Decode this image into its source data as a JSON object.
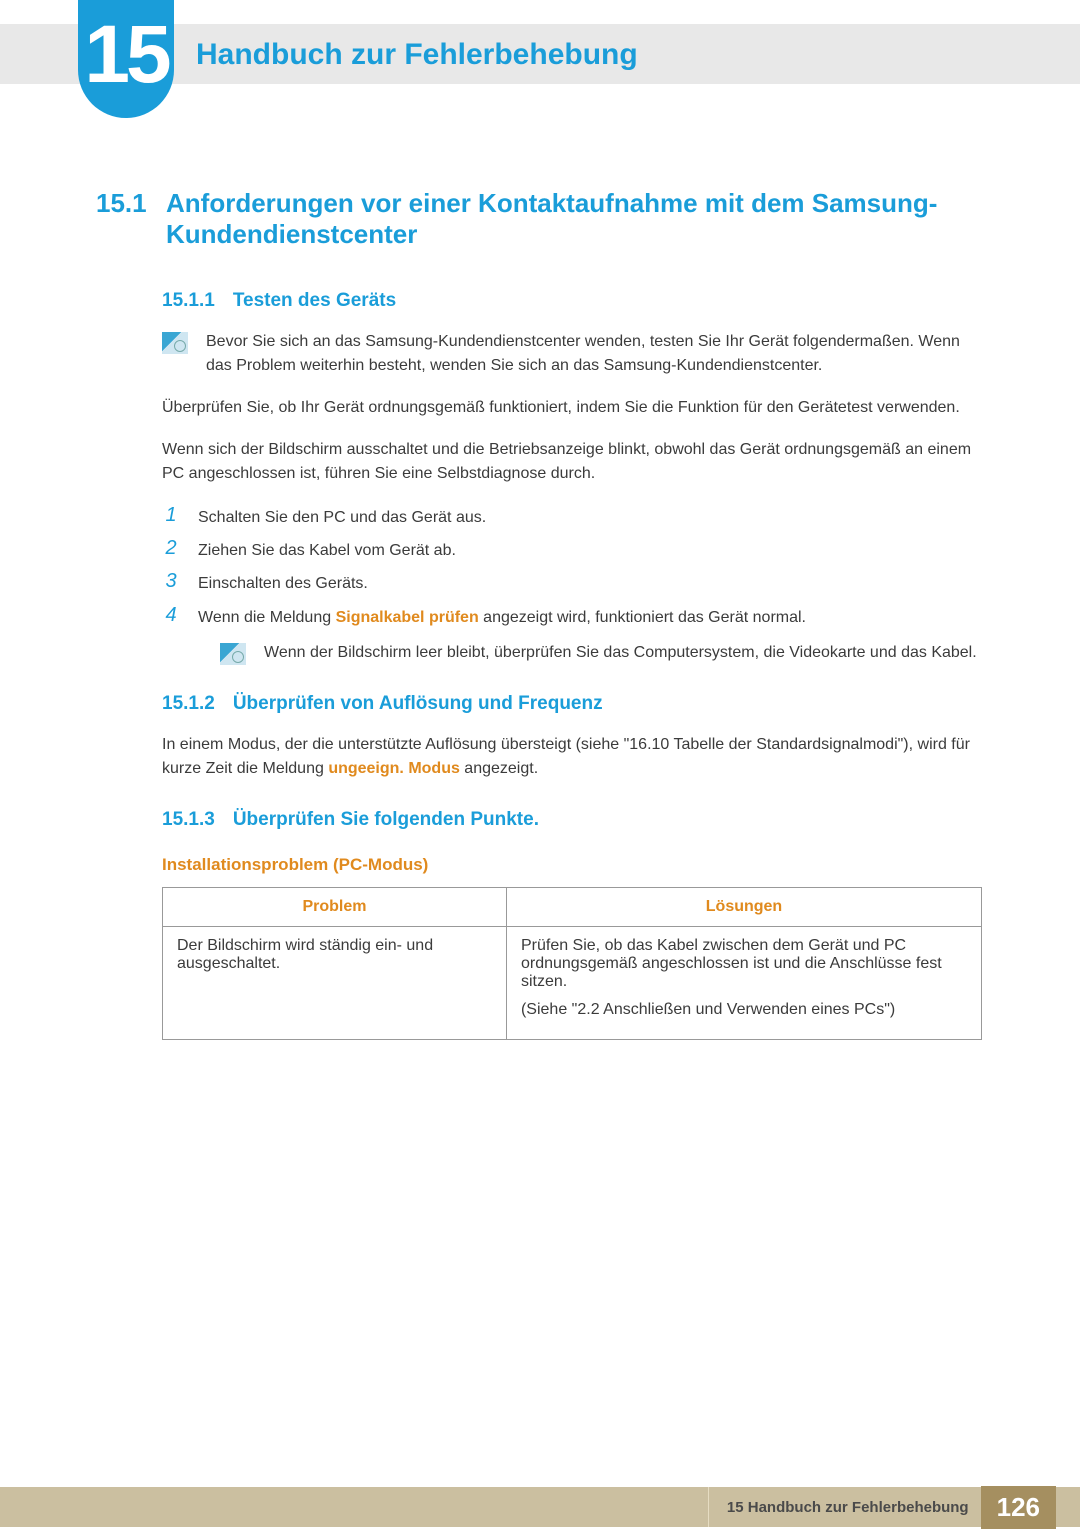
{
  "chapter": {
    "number": "15",
    "title": "Handbuch zur Fehlerbehebung"
  },
  "section_1": {
    "number": "15.1",
    "title": "Anforderungen vor einer Kontaktaufnahme mit dem Samsung-Kundendienstcenter"
  },
  "s1511": {
    "number": "15.1.1",
    "title": "Testen des Geräts",
    "note": "Bevor Sie sich an das Samsung-Kundendienstcenter wenden, testen Sie Ihr Gerät folgendermaßen. Wenn das Problem weiterhin besteht, wenden Sie sich an das Samsung-Kundendienstcenter.",
    "p1": "Überprüfen Sie, ob Ihr Gerät ordnungsgemäß funktioniert, indem Sie die Funktion für den Gerätetest verwenden.",
    "p2": "Wenn sich der Bildschirm ausschaltet und die Betriebsanzeige blinkt, obwohl das Gerät ordnungsgemäß an einem PC angeschlossen ist, führen Sie eine Selbstdiagnose durch.",
    "steps": [
      "Schalten Sie den PC und das Gerät aus.",
      "Ziehen Sie das Kabel vom Gerät ab.",
      "Einschalten des Geräts."
    ],
    "step4_pre": "Wenn die Meldung ",
    "step4_orange": "Signalkabel prüfen",
    "step4_post": " angezeigt wird, funktioniert das Gerät normal.",
    "note2": "Wenn der Bildschirm leer bleibt, überprüfen Sie das Computersystem, die Videokarte und das Kabel."
  },
  "s1512": {
    "number": "15.1.2",
    "title": "Überprüfen von Auflösung und Frequenz",
    "p_pre": "In einem Modus, der die unterstützte Auflösung übersteigt (siehe \"16.10 Tabelle der Standardsignalmodi\"), wird für kurze Zeit die Meldung ",
    "p_orange": "ungeeign. Modus",
    "p_post": " angezeigt."
  },
  "s1513": {
    "number": "15.1.3",
    "title": "Überprüfen Sie folgenden Punkte.",
    "h4": "Installationsproblem (PC-Modus)",
    "table": {
      "h1": "Problem",
      "h2": "Lösungen",
      "row1_problem": "Der Bildschirm wird ständig ein- und ausgeschaltet.",
      "row1_sol_a": "Prüfen Sie, ob das Kabel zwischen dem Gerät und PC ordnungsgemäß angeschlossen ist und die Anschlüsse fest sitzen.",
      "row1_sol_b": "(Siehe \"2.2 Anschließen und Verwenden eines PCs\")"
    }
  },
  "footer": {
    "label": "15 Handbuch zur Fehlerbehebung",
    "page": "126"
  }
}
